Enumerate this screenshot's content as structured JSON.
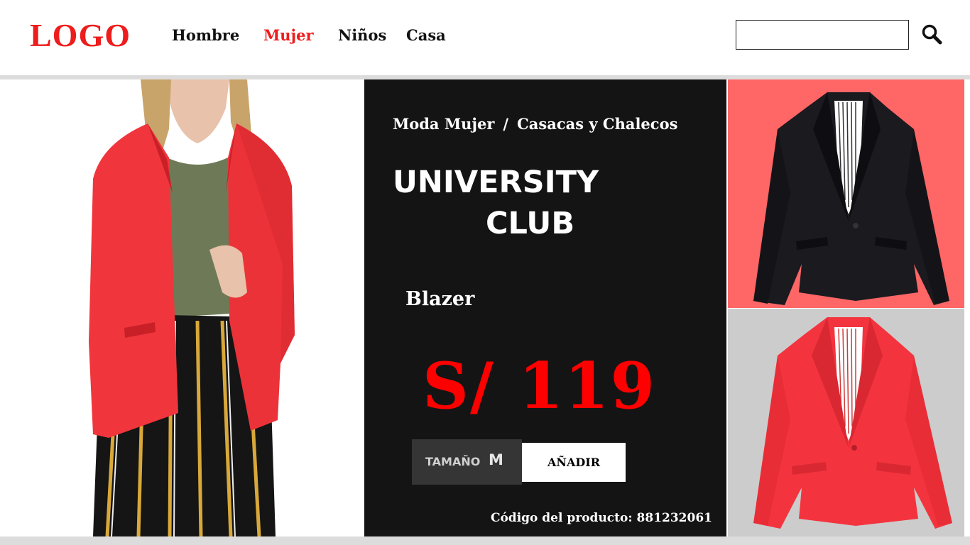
{
  "header": {
    "logo": "LOGO",
    "nav": [
      {
        "label": "Hombre",
        "active": false
      },
      {
        "label": "Mujer",
        "active": true
      },
      {
        "label": "Niños",
        "active": false
      },
      {
        "label": "Casa",
        "active": false
      }
    ],
    "search": {
      "value": "",
      "placeholder": ""
    },
    "search_icon": "search-icon"
  },
  "product": {
    "breadcrumb": [
      "Moda Mujer",
      "Casacas y Chalecos"
    ],
    "breadcrumb_separator": "/",
    "brand_line1": "UNIVERSITY",
    "brand_line2": "CLUB",
    "type": "Blazer",
    "price": "S/ 119",
    "size_label": "TAMAÑO",
    "size_value": "M",
    "add_label": "AÑADIR",
    "code_text": "Código del producto: 881232061"
  },
  "thumbnails": [
    {
      "name": "black-blazer",
      "background": "#ff6666",
      "jacket_color": "#1a1a1f"
    },
    {
      "name": "red-blazer",
      "background": "#cccccc",
      "jacket_color": "#f3343e"
    }
  ],
  "colors": {
    "accent": "#ee1c1c",
    "price": "#ff0000",
    "panel": "#141414",
    "size_box": "#353535"
  }
}
